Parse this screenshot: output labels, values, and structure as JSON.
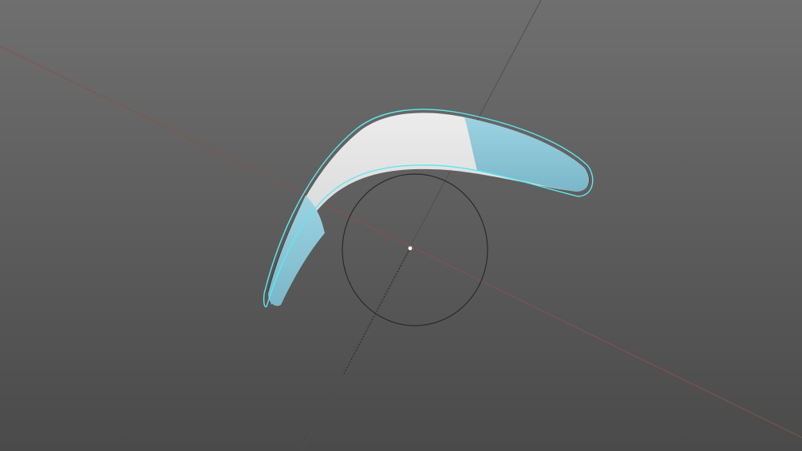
{
  "viewport": {
    "background_top": "#6f6f6f",
    "background_bottom": "#4a4a4a",
    "x_axis_color": "#8a5050",
    "z_axis_color": "#4a4a4a",
    "dashed_axis_color": "#2a2a2a",
    "gizmo_circle_color": "#2a2a2a",
    "pivot_color": "#ffffff"
  },
  "model": {
    "name": "boomerang",
    "selected": true,
    "selection_outline_color": "#5ee8f0",
    "body_color_white": "#dedede",
    "body_color_blue": "#8ec8d8",
    "shadow_color": "#404040"
  }
}
